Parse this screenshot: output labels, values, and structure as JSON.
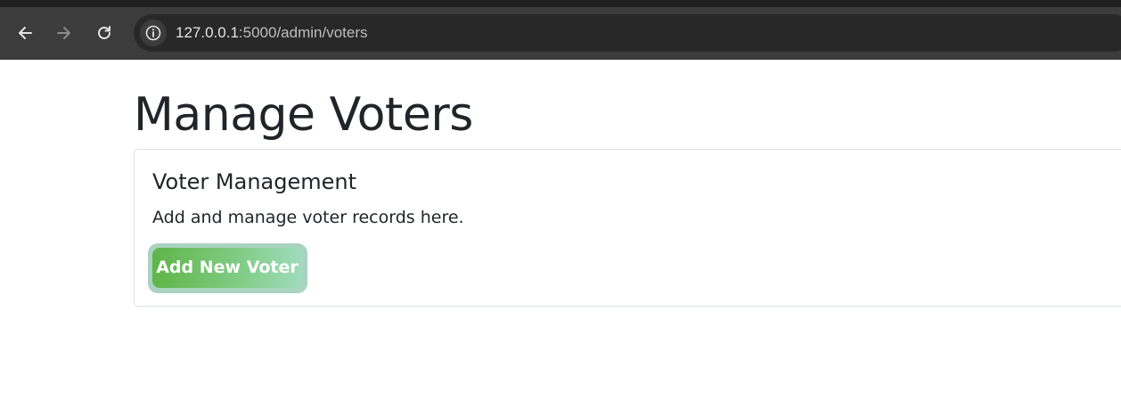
{
  "browser": {
    "url_host": "127.0.0.1",
    "url_path": ":5000/admin/voters",
    "icons": {
      "back": "arrow-left-icon",
      "forward": "arrow-right-icon",
      "reload": "reload-icon",
      "site_info": "info-icon"
    }
  },
  "page": {
    "title": "Manage Voters"
  },
  "card": {
    "title": "Voter Management",
    "text": "Add and manage voter records here.",
    "button_label": "Add New Voter"
  },
  "colors": {
    "button_gradient_start": "#5fb548",
    "button_gradient_end": "#9fdcbc",
    "text": "#212529",
    "chrome_bg": "#3c3c3c",
    "omnibox_bg": "#282828"
  }
}
